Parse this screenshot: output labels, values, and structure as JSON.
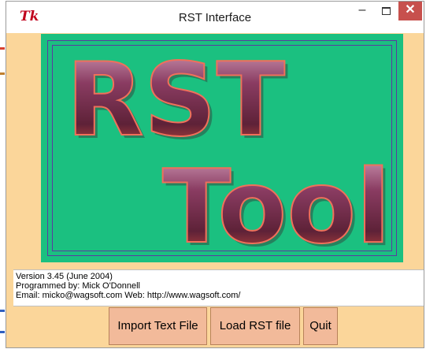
{
  "window": {
    "title": "RST Interface",
    "app_icon_glyph": "Tk",
    "controls": {
      "minimize": "–",
      "maximize_icon": "maximize-icon",
      "close": "✕"
    }
  },
  "logo": {
    "line1": "RST",
    "line2": "Tool",
    "background_color": "#1bc080",
    "text_color": "#7a3550"
  },
  "info": {
    "version": "Version 3.45 (June 2004)",
    "programmer": "Programmed by: Mick O'Donnell",
    "contact": "Email: micko@wagsoft.com    Web: http://www.wagsoft.com/"
  },
  "buttons": {
    "import": "Import Text File",
    "load": "Load RST file",
    "quit": "Quit"
  }
}
